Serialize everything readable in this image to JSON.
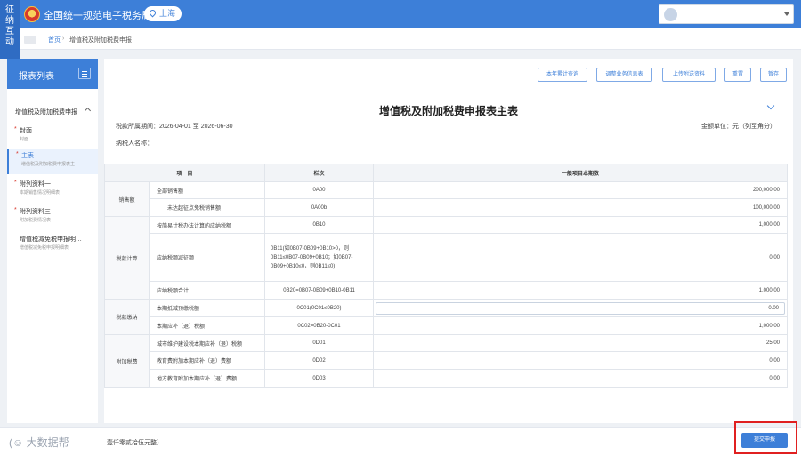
{
  "header": {
    "side_tab": [
      "征",
      "纳",
      "互",
      "动"
    ],
    "site_title": "全国统一规范电子税务局",
    "region": "上海"
  },
  "breadcrumb": {
    "home": "首页",
    "separator": "›",
    "current": "增值税及附加税费申报"
  },
  "left_panel": {
    "title": "报表列表",
    "group_title": "增值税及附加税费申报",
    "items": [
      {
        "label": "封面",
        "sub": "封面",
        "required": true
      },
      {
        "label": "主表",
        "sub": "增值税及附加税费申报表主",
        "required": true
      },
      {
        "label": "附列资料一",
        "sub": "本期销售情况明细表",
        "required": true
      },
      {
        "label": "附列资料三",
        "sub": "附加税费情况表",
        "required": true
      },
      {
        "label": "增值税减免税申报明…",
        "sub": "增值税减免税申报明细表",
        "required": false
      }
    ]
  },
  "toolbar": {
    "btn_yearly": "本年累计查询",
    "btn_adjust": "调整业务信息表",
    "btn_upload": "上传附送资料",
    "btn_reset": "重置",
    "btn_save": "暂存"
  },
  "form": {
    "title": "增值税及附加税费申报表主表",
    "period_label": "税款所属期间：2026-04-01 至 2026-06-30",
    "unit_label": "金额单位：元（列至角分）",
    "taxpayer_label": "纳税人名称："
  },
  "table": {
    "headers": {
      "item": "项　目",
      "code": "栏次",
      "amount": "一般项目本期数"
    },
    "groups": {
      "sales": "销售额",
      "calc": "税款计算",
      "payment": "税款缴纳",
      "surtax": "附加税费"
    },
    "rows": [
      {
        "item": "全部销售额",
        "code": "0A00",
        "value": "200,000.00"
      },
      {
        "item": "未达起征点免税销售额",
        "code": "0A00b",
        "value": "100,000.00"
      },
      {
        "item": "按简易计税办法计算的应纳税额",
        "code": "0B10",
        "value": "1,000.00"
      },
      {
        "item": "应纳税额减征额",
        "code": "0B11(如0B07-0B09+0B10>0，则0B11≤0B07-0B09+0B10；如0B07-0B09+0B10≤0，则0B11≤0)",
        "value": "0.00"
      },
      {
        "item": "应纳税额合计",
        "code": "0B20=0B07-0B09+0B10-0B11",
        "value": "1,000.00"
      },
      {
        "item": "本期抵减预缴税额",
        "code": "0C01(0C01≤0B20)",
        "value": "0.00"
      },
      {
        "item": "本期应补（退）税额",
        "code": "0C02=0B20-0C01",
        "value": "1,000.00"
      },
      {
        "item": "城市维护建设税本期应补（退）税额",
        "code": "0D01",
        "value": "25.00"
      },
      {
        "item": "教育费附加本期应补（退）费额",
        "code": "0D02",
        "value": "0.00"
      },
      {
        "item": "地方教育附加本期应补（退）费额",
        "code": "0D03",
        "value": "0.00"
      }
    ]
  },
  "bottom": {
    "watermark": "(☺ 大数据帮",
    "amount_tail": "壹仟零贰拾伍元整）",
    "submit": "提交申报"
  },
  "colors": {
    "brand_blue": "#3d7fd8",
    "highlight_red": "#e02020"
  }
}
